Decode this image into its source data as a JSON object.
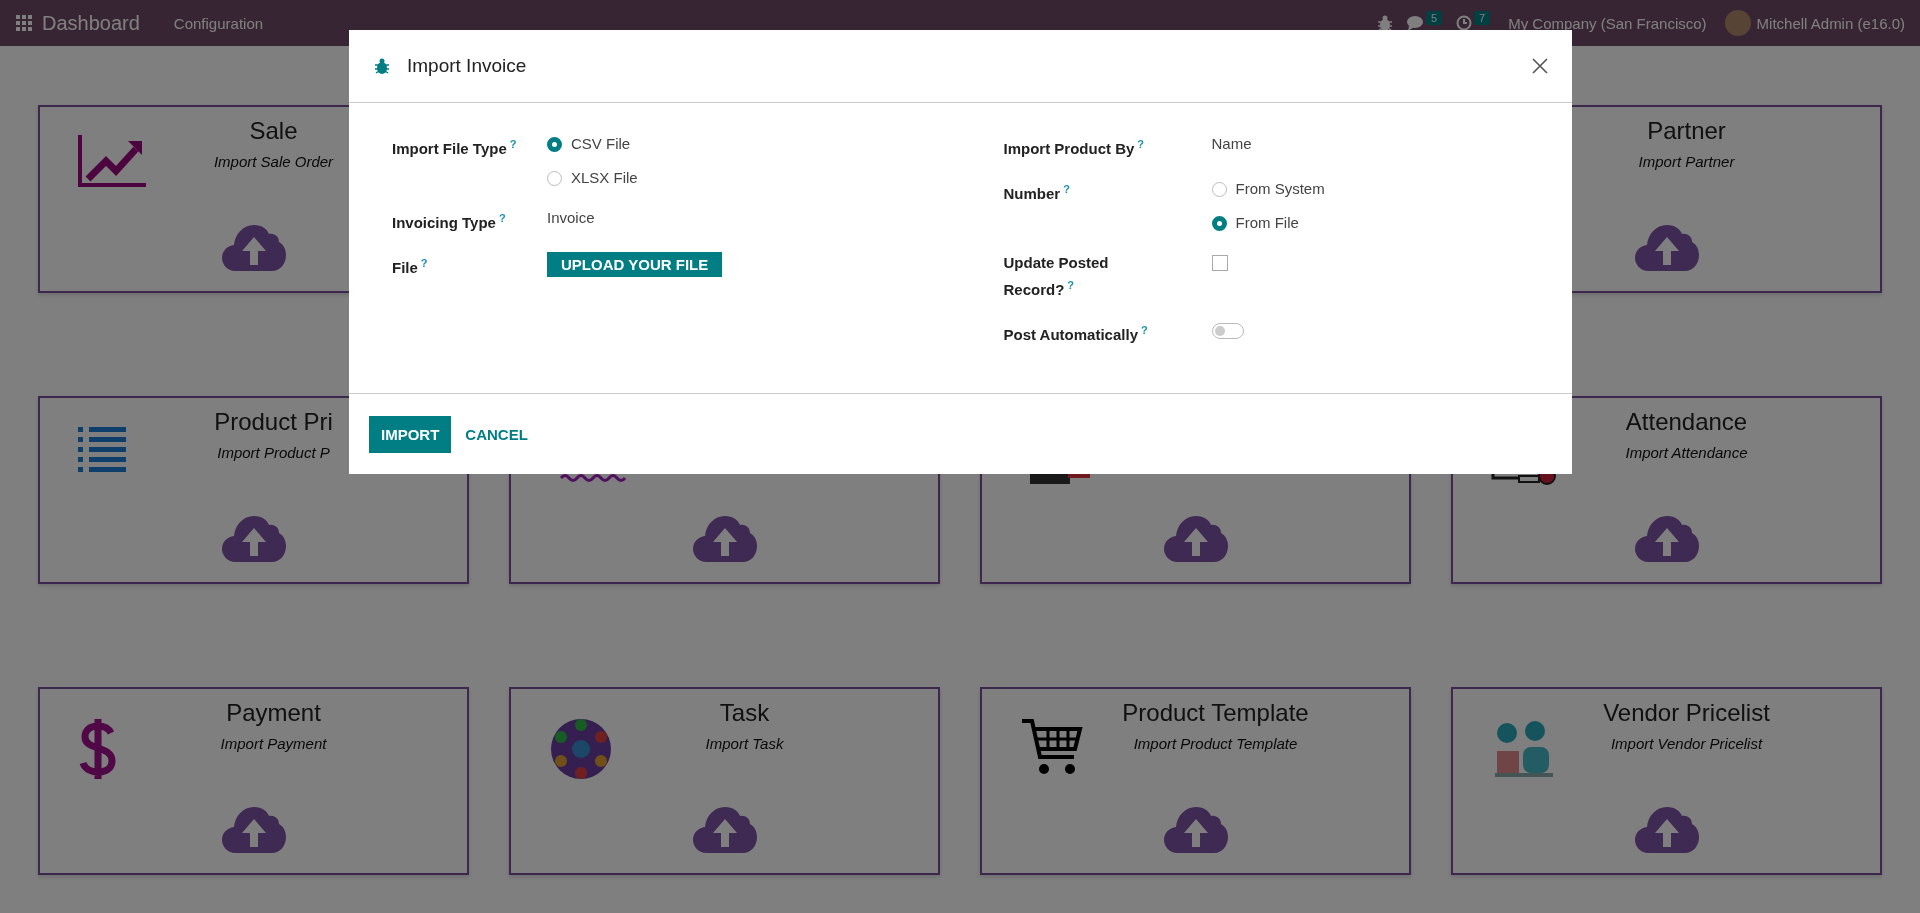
{
  "navbar": {
    "app_name": "Dashboard",
    "menu": [
      "Configuration"
    ],
    "chat_badge": "5",
    "activity_badge": "7",
    "company": "My Company (San Francisco)",
    "user": "Mitchell Admin (e16.0)"
  },
  "cards": [
    {
      "kind": "card",
      "title": "Sale",
      "subtitle": "Import Sale Order"
    },
    {
      "kind": "covered"
    },
    {
      "kind": "covered"
    },
    {
      "kind": "card",
      "title": "Partner",
      "subtitle": "Import Partner"
    },
    {
      "kind": "card",
      "title": "Product Pri",
      "subtitle": "Import Product P"
    },
    {
      "kind": "card"
    },
    {
      "kind": "card"
    },
    {
      "kind": "card",
      "title": "Attendance",
      "subtitle": "Import Attendance"
    },
    {
      "kind": "card",
      "title": "Payment",
      "subtitle": "Import Payment"
    },
    {
      "kind": "card",
      "title": "Task",
      "subtitle": "Import Task"
    },
    {
      "kind": "card",
      "title": "Product Template",
      "subtitle": "Import Product Template"
    },
    {
      "kind": "card",
      "title": "Vendor Pricelist",
      "subtitle": "Import Vendor Pricelist"
    }
  ],
  "dialog": {
    "title": "Import Invoice",
    "left_fields": [
      {
        "kind": "radio",
        "label": "Import File Type",
        "help": "?",
        "options": [
          {
            "label": "CSV File",
            "selected": true
          },
          {
            "label": "XLSX File",
            "selected": false
          }
        ]
      },
      {
        "kind": "text",
        "label": "Invoicing Type",
        "help": "?",
        "value": "Invoice"
      },
      {
        "kind": "upload",
        "label": "File",
        "help": "?",
        "button": "UPLOAD YOUR FILE"
      }
    ],
    "right_fields": [
      {
        "kind": "text",
        "label": "Import Product By",
        "help": "?",
        "value": "Name"
      },
      {
        "kind": "radio",
        "label": "Number",
        "help": "?",
        "options": [
          {
            "label": "From System",
            "selected": false
          },
          {
            "label": "From File",
            "selected": true
          }
        ]
      },
      {
        "kind": "checkbox",
        "label": "Update Posted Record?",
        "help": "?",
        "checked": false
      },
      {
        "kind": "toggle",
        "label": "Post Automatically",
        "help": "?",
        "on": false
      }
    ],
    "buttons": [
      {
        "label": "IMPORT",
        "kind": "primary"
      },
      {
        "label": "CANCEL",
        "kind": "link"
      }
    ]
  }
}
